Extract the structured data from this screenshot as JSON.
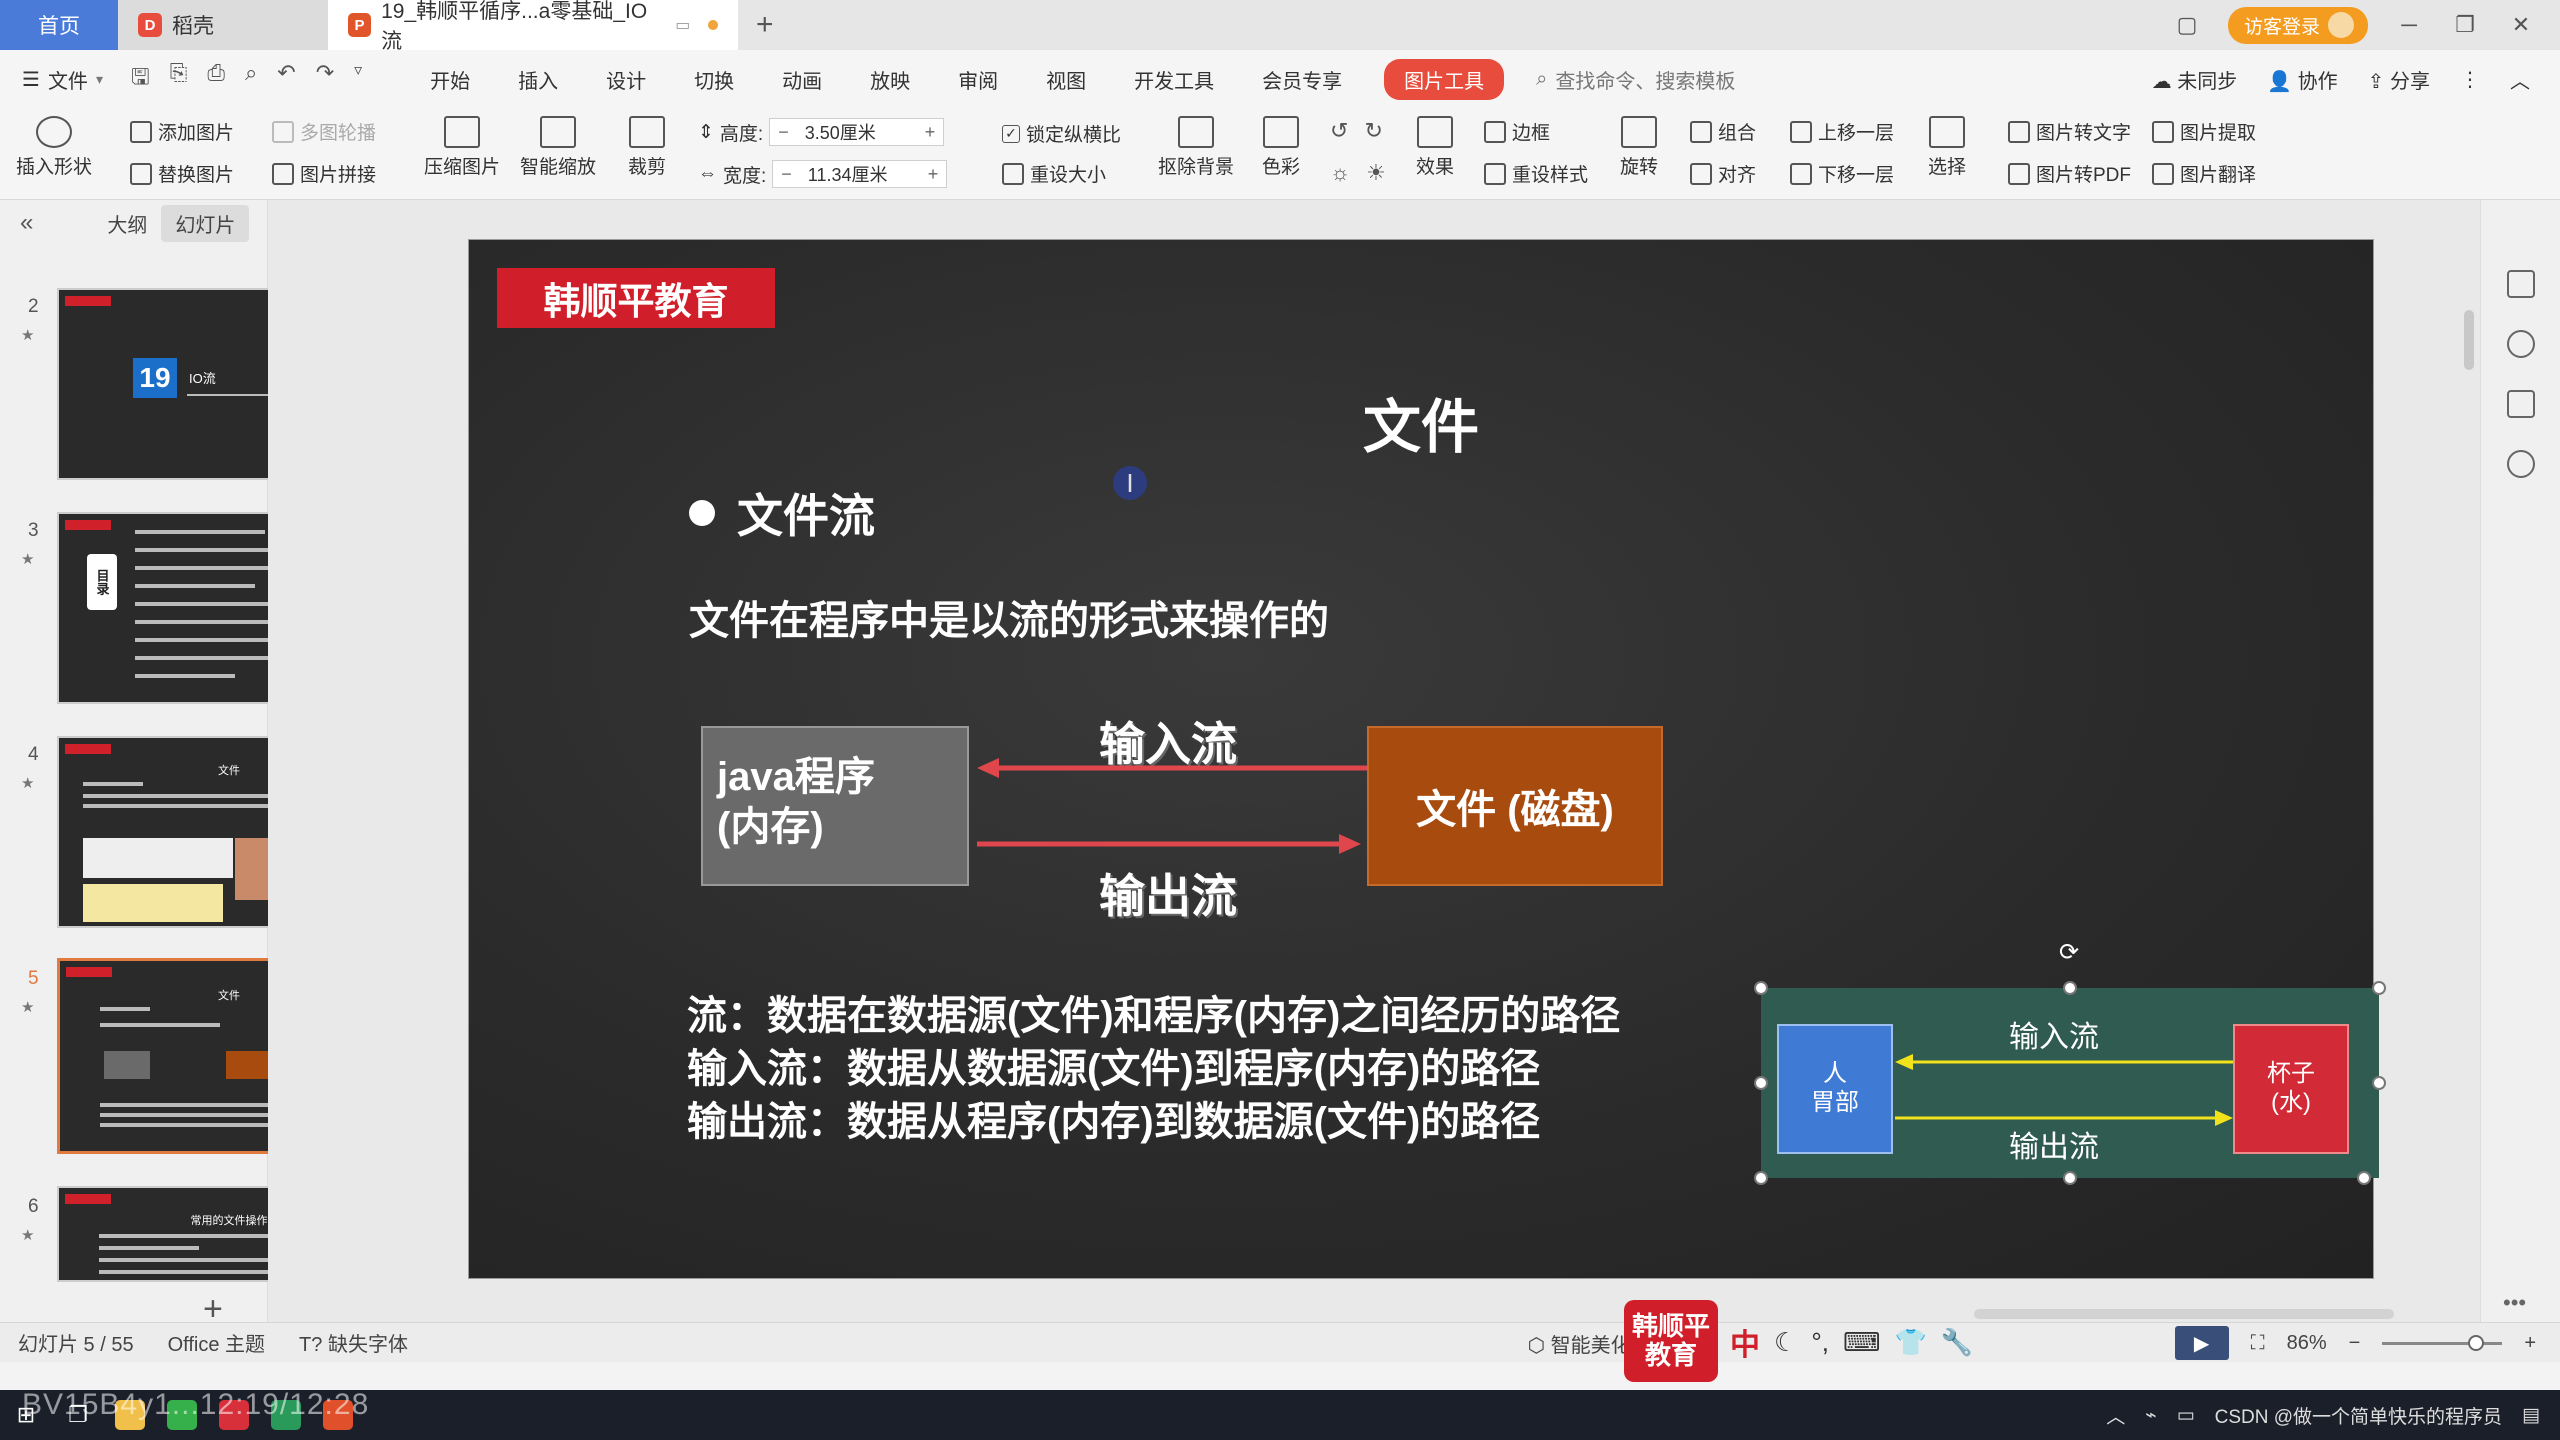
{
  "tabs": {
    "home": "首页",
    "daoke": "稻壳",
    "document": "19_韩顺平循序...a零基础_IO流"
  },
  "window": {
    "login": "访客登录"
  },
  "menu": {
    "file": "文件",
    "items": [
      "开始",
      "插入",
      "设计",
      "切换",
      "动画",
      "放映",
      "审阅",
      "视图",
      "开发工具",
      "会员专享"
    ],
    "active": "图片工具",
    "search": "查找命令、搜索模板",
    "sync": "未同步",
    "collab": "协作",
    "share": "分享"
  },
  "ribbon": {
    "insert_shape": "插入形状",
    "add_image": "添加图片",
    "multi_carousel": "多图轮播",
    "replace_image": "替换图片",
    "image_collage": "图片拼接",
    "compress": "压缩图片",
    "smart_scale": "智能缩放",
    "crop": "裁剪",
    "height_label": "高度:",
    "height_value": "3.50厘米",
    "width_label": "宽度:",
    "width_value": "11.34厘米",
    "lock_ratio": "锁定纵横比",
    "reset_size": "重设大小",
    "remove_bg": "抠除背景",
    "color": "色彩",
    "effects": "效果",
    "border": "边框",
    "reset_style": "重设样式",
    "rotate": "旋转",
    "group": "组合",
    "align": "对齐",
    "bring_forward": "上移一层",
    "send_backward": "下移一层",
    "select": "选择",
    "img_to_text": "图片转文字",
    "img_extract": "图片提取",
    "img_to_pdf": "图片转PDF",
    "img_translate": "图片翻译"
  },
  "leftpanel": {
    "outline": "大纲",
    "slides": "幻灯片",
    "thumbs": [
      {
        "num": "2",
        "title": "IO流",
        "big": "19"
      },
      {
        "num": "3",
        "title": "目录"
      },
      {
        "num": "4",
        "title": "文件"
      },
      {
        "num": "5",
        "title": "文件"
      },
      {
        "num": "6",
        "title": "常用的文件操作"
      }
    ],
    "add": "+"
  },
  "slide": {
    "brand": "韩顺平教育",
    "title": "文件",
    "bullet": "文件流",
    "subtitle": "文件在程序中是以流的形式来操作的",
    "java_box": [
      "java程序",
      "(内存)"
    ],
    "file_box": "文件 (磁盘)",
    "input_stream": "输入流",
    "output_stream": "输出流",
    "definitions": [
      "流：数据在数据源(文件)和程序(内存)之间经历的路径",
      "输入流：数据从数据源(文件)到程序(内存)的路径",
      "输出流：数据从程序(内存)到数据源(文件)的路径"
    ],
    "mini": {
      "left": [
        "人",
        "胃部"
      ],
      "right": [
        "杯子",
        "(水)"
      ],
      "input": "输入流",
      "output": "输出流"
    }
  },
  "status": {
    "slide_info": "幻灯片 5 / 55",
    "theme": "Office 主题",
    "missing_font": "缺失字体",
    "beautify": "智能美化",
    "zoom": "86%"
  },
  "overlay": {
    "logo": "韩顺平教育",
    "ime": "中",
    "watermark": "BV15B4y1...12:19/12:28",
    "tray_text": "CSDN @做一个简单快乐的程序员"
  },
  "colors": {
    "accent": "#e74c3c",
    "home_tab": "#4a7bd9",
    "brand_red": "#d01f2a",
    "file_box": "#a84b0f",
    "arrow_red": "#e0474c",
    "arrow_yellow": "#f2e21c"
  }
}
